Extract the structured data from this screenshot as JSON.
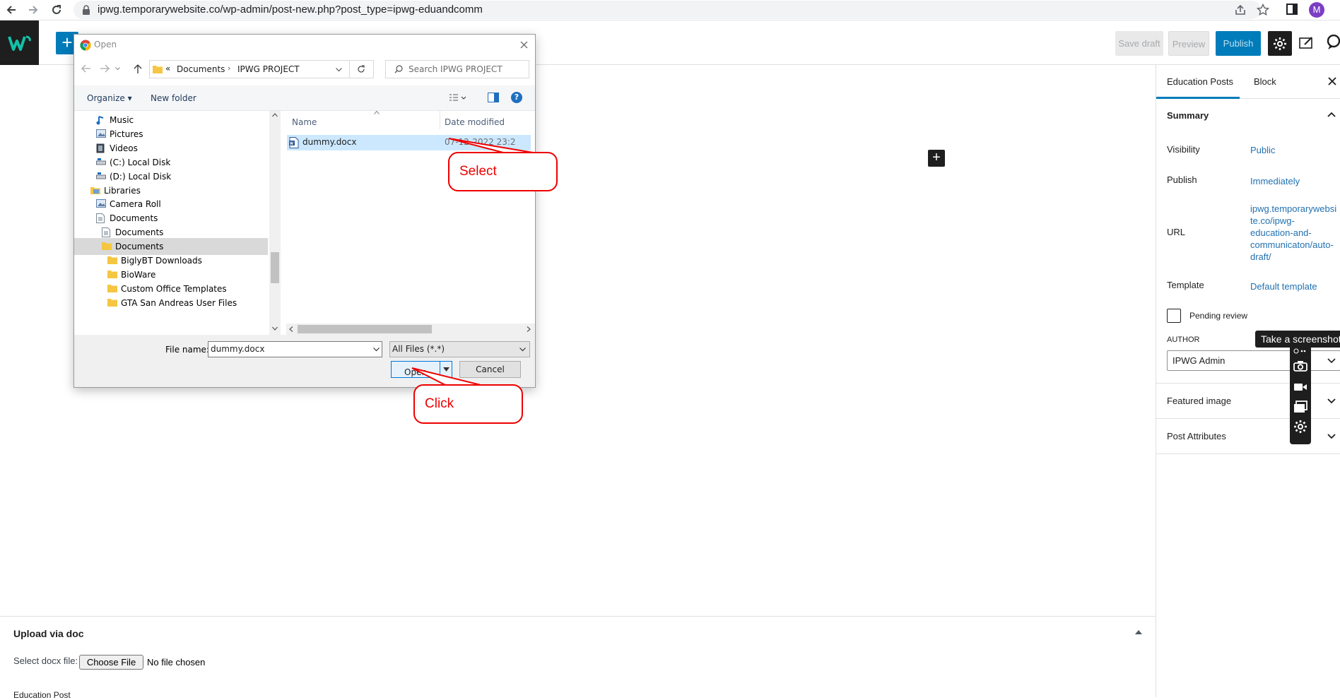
{
  "browser": {
    "url": "ipwg.temporarywebsite.co/wp-admin/post-new.php?post_type=ipwg-eduandcomm",
    "profile_initial": "M"
  },
  "header": {
    "save_draft": "Save draft",
    "preview": "Preview",
    "publish": "Publish"
  },
  "sidebar": {
    "tabs": [
      "Education Posts",
      "Block"
    ],
    "summary_title": "Summary",
    "visibility_label": "Visibility",
    "visibility_value": "Public",
    "publish_label": "Publish",
    "publish_value": "Immediately",
    "url_label": "URL",
    "url_lines": [
      "ipwg.temporarywebsi",
      "te.co/ipwg-",
      "education-and-",
      "communicaton/auto-",
      "draft/"
    ],
    "template_label": "Template",
    "template_value": "Default template",
    "pending_review": "Pending review",
    "author_label": "AUTHOR",
    "author_value": "IPWG Admin",
    "featured_image": "Featured image",
    "post_attributes": "Post Attributes"
  },
  "screenshot_tool": {
    "tooltip": "Take a screenshot"
  },
  "upload": {
    "title": "Upload via doc",
    "label": "Select docx file:",
    "choose_button": "Choose File",
    "no_file": "No file chosen",
    "bottom_crumb": "Education Post"
  },
  "dialog": {
    "title": "Open",
    "breadcrumb_root": "«",
    "breadcrumb": [
      "Documents",
      "IPWG PROJECT"
    ],
    "search_placeholder": "Search IPWG PROJECT",
    "organize": "Organize ▾",
    "new_folder": "New folder",
    "nav_items": [
      {
        "label": "Music",
        "icon": "music-icon"
      },
      {
        "label": "Pictures",
        "icon": "pictures-icon"
      },
      {
        "label": "Videos",
        "icon": "videos-icon"
      },
      {
        "label": "(C:) Local Disk",
        "icon": "drive-icon"
      },
      {
        "label": "(D:) Local Disk",
        "icon": "drive-icon"
      },
      {
        "label": "Libraries",
        "icon": "library-icon"
      },
      {
        "label": "Camera Roll",
        "icon": "pictures-icon"
      },
      {
        "label": "Documents",
        "icon": "documents-icon"
      },
      {
        "label": "Documents",
        "icon": "documents-icon"
      },
      {
        "label": "Documents",
        "icon": "folder-icon"
      },
      {
        "label": "BiglyBT Downloads",
        "icon": "folder-icon"
      },
      {
        "label": "BioWare",
        "icon": "folder-icon"
      },
      {
        "label": "Custom Office Templates",
        "icon": "folder-icon"
      },
      {
        "label": "GTA San Andreas User Files",
        "icon": "folder-icon"
      }
    ],
    "columns": [
      "Name",
      "Date modified"
    ],
    "file_name": "dummy.docx",
    "file_date": "07-12-2022 23:2",
    "file_name_label": "File name:",
    "file_name_value": "dummy.docx",
    "file_type": "All Files (*.*)",
    "open_button": "Open",
    "cancel_button": "Cancel"
  },
  "annotations": {
    "select": "Select",
    "click": "Click"
  },
  "colors": {
    "accent": "#007cba",
    "annotation": "#e00000",
    "selection": "#cce8ff"
  }
}
